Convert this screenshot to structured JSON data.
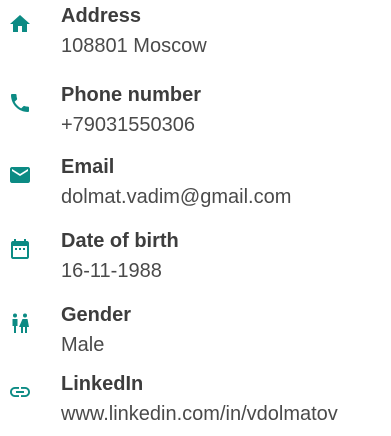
{
  "accent_color": "#0c8b84",
  "items": [
    {
      "icon": "home-icon",
      "label": "Address",
      "value": "108801 Moscow"
    },
    {
      "icon": "phone-icon",
      "label": "Phone number",
      "value": "+79031550306"
    },
    {
      "icon": "email-icon",
      "label": "Email",
      "value": "dolmat.vadim@gmail.com"
    },
    {
      "icon": "calendar-icon",
      "label": "Date of birth",
      "value": "16-11-1988"
    },
    {
      "icon": "gender-icon",
      "label": "Gender",
      "value": "Male"
    },
    {
      "icon": "link-icon",
      "label": "LinkedIn",
      "value": "www.linkedin.com/in/vdolmatov"
    }
  ]
}
